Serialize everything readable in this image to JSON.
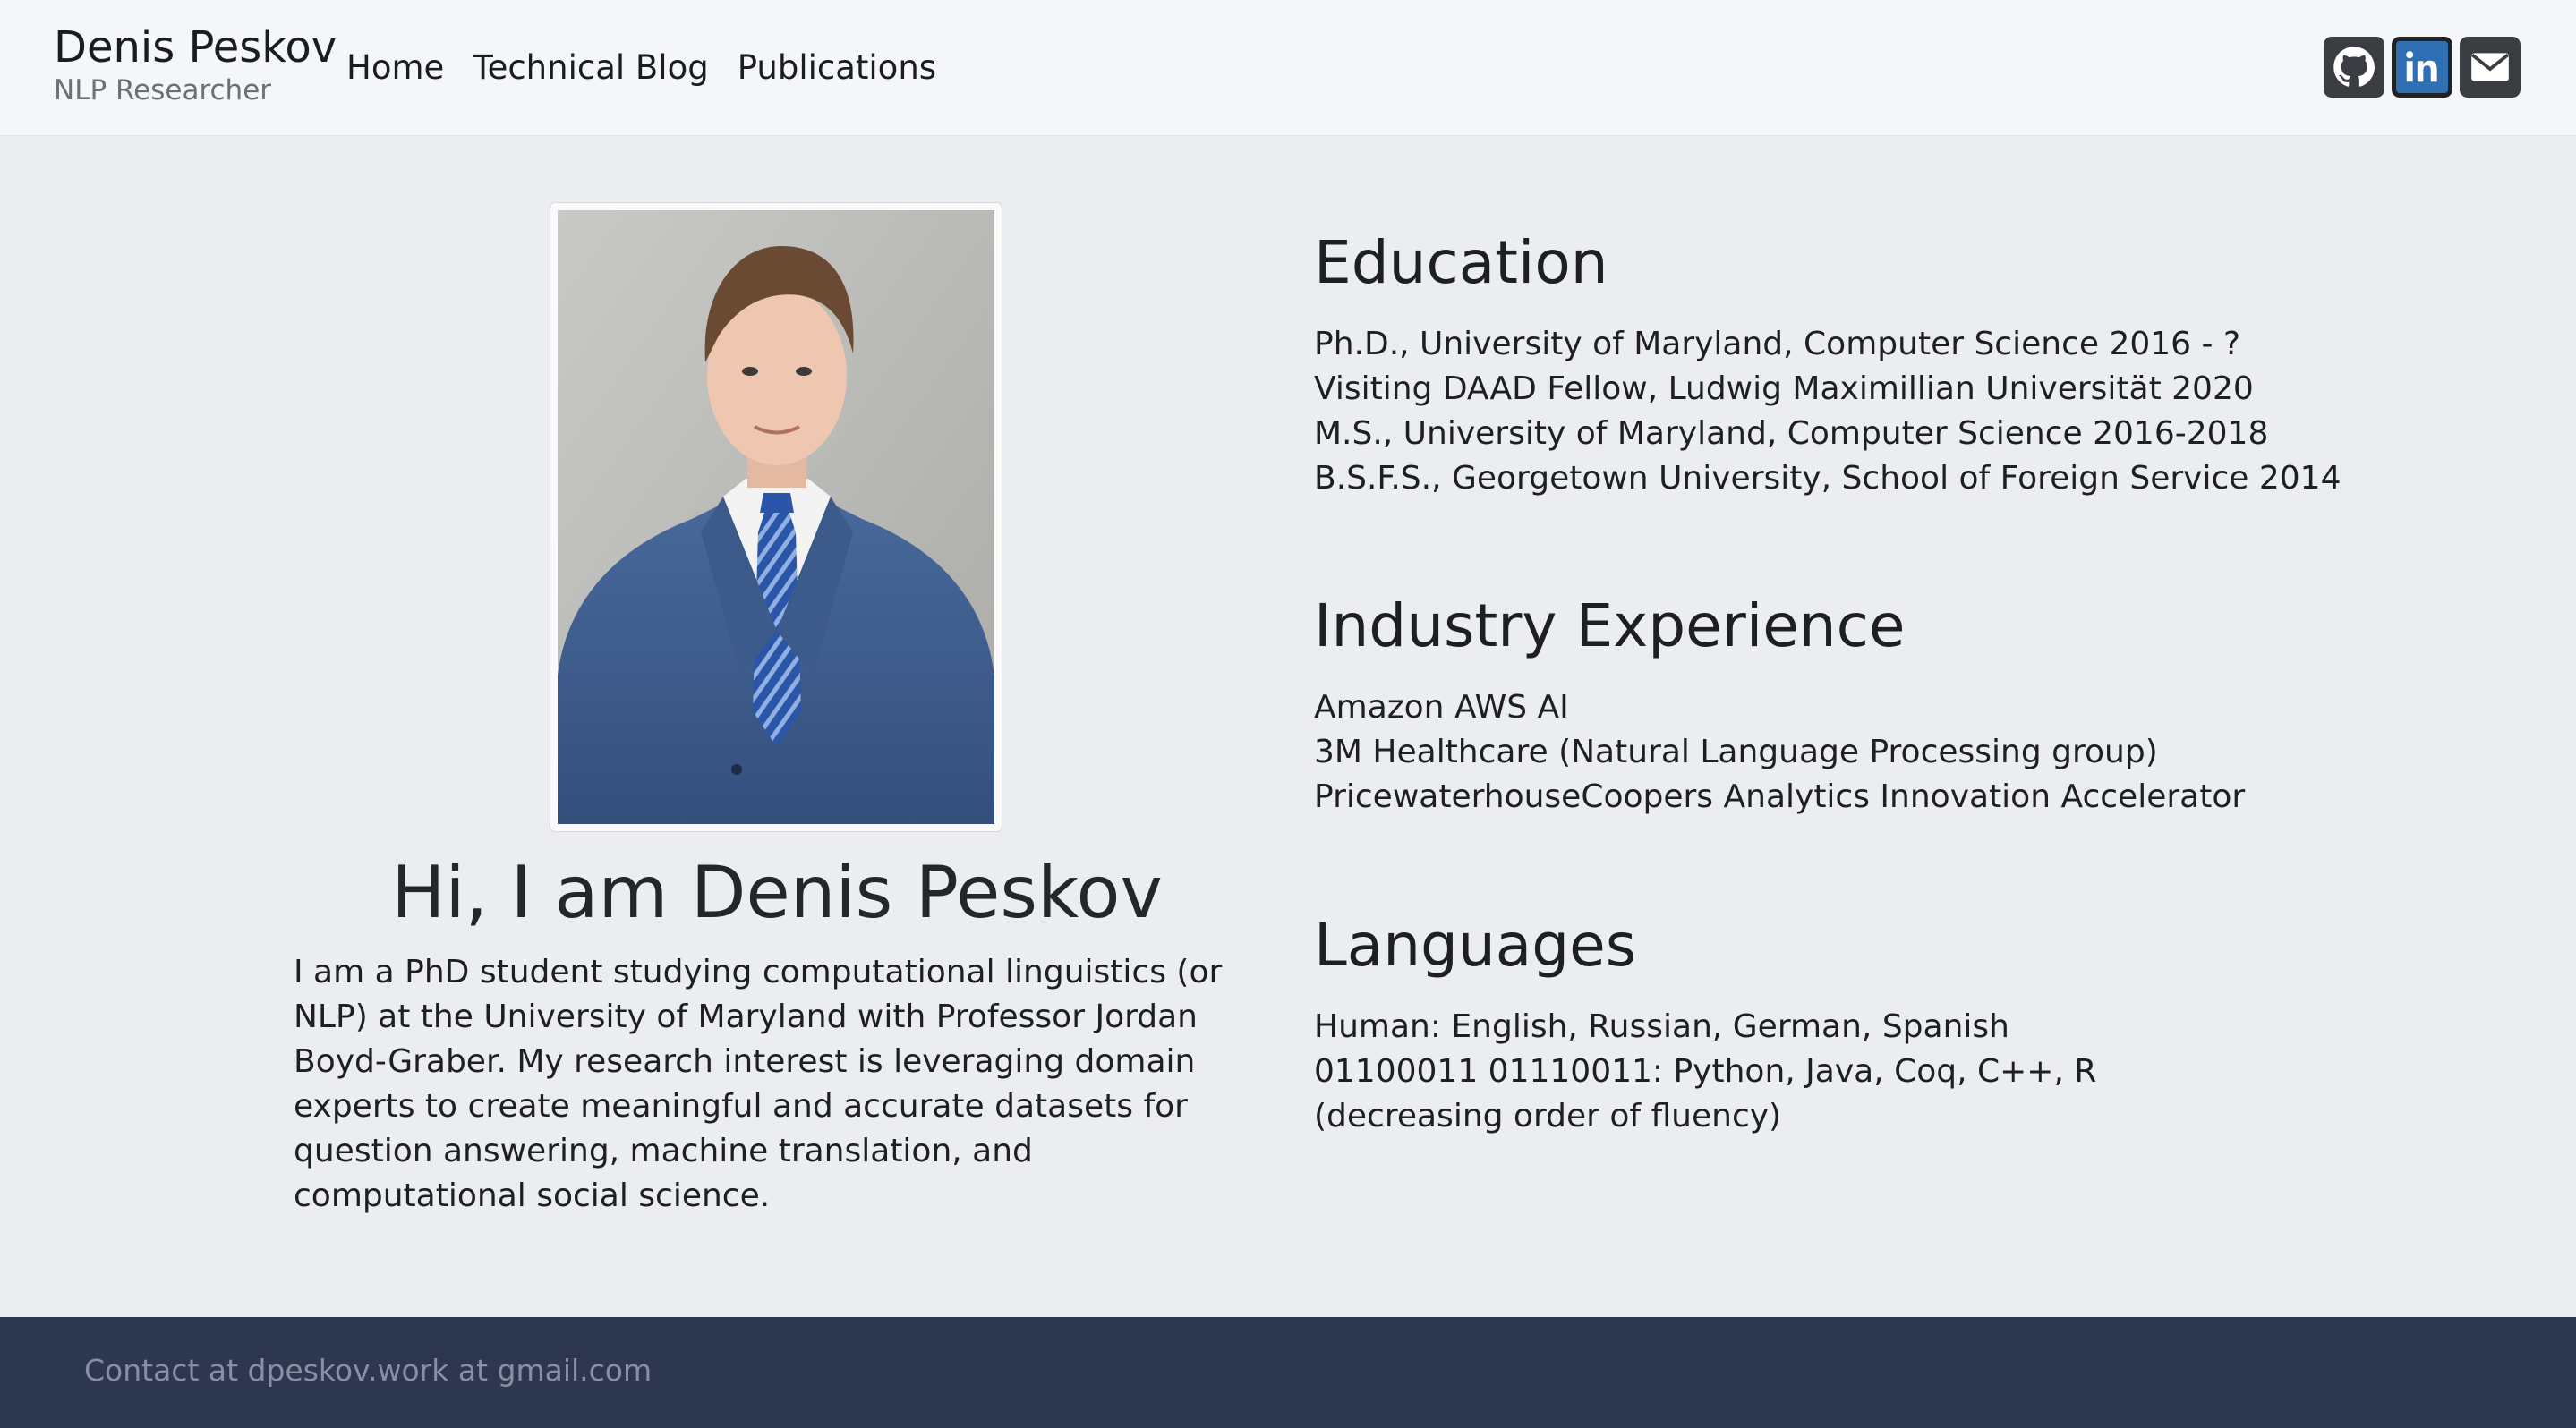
{
  "header": {
    "brand_name": "Denis Peskov",
    "brand_subtitle": "NLP Researcher",
    "nav": [
      {
        "label": "Home"
      },
      {
        "label": "Technical Blog"
      },
      {
        "label": "Publications"
      }
    ],
    "social": [
      {
        "icon": "github-icon"
      },
      {
        "icon": "linkedin-icon"
      },
      {
        "icon": "email-icon"
      }
    ]
  },
  "hero": {
    "title": "Hi, I am Denis Peskov",
    "intro": "I am a PhD student studying computational linguistics (or NLP) at the University of Maryland with Professor Jordan Boyd-Graber. My research interest is leveraging domain experts to create meaningful and accurate datasets for question answering, machine translation, and computational social science."
  },
  "education": {
    "heading": "Education",
    "lines": [
      "Ph.D., University of Maryland, Computer Science 2016 - ?",
      "Visiting DAAD Fellow, Ludwig Maximillian Universität 2020",
      "M.S., University of Maryland, Computer Science 2016-2018",
      "B.S.F.S., Georgetown University, School of Foreign Service 2014"
    ]
  },
  "industry": {
    "heading": "Industry Experience",
    "lines": [
      "Amazon AWS AI",
      "3M Healthcare (Natural Language Processing group)",
      "PricewaterhouseCoopers Analytics Innovation Accelerator"
    ]
  },
  "languages": {
    "heading": "Languages",
    "lines": [
      "Human: English, Russian, German, Spanish",
      "01100011 01110011: Python, Java, Coq, C++, R",
      "(decreasing order of fluency)"
    ]
  },
  "footer": {
    "text": "Contact at dpeskov.work at gmail.com"
  },
  "colors": {
    "header_bg": "#f5f6f7",
    "page_bg": "#ecedf0",
    "footer_bg": "#2d3850",
    "linkedin": "#2f6fb3"
  }
}
